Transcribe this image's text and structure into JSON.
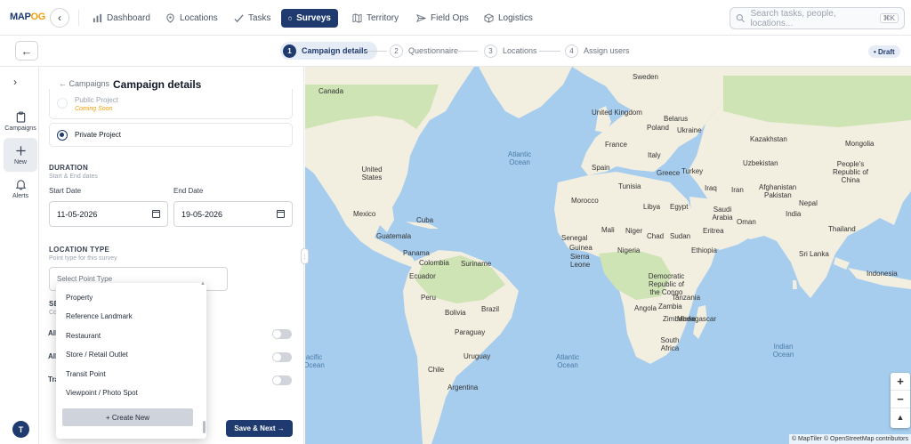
{
  "app": {
    "logo_main": "MAP",
    "logo_accent": "OG"
  },
  "nav": {
    "items": [
      {
        "label": "Dashboard",
        "icon": "bar-chart-icon"
      },
      {
        "label": "Locations",
        "icon": "map-pin-icon"
      },
      {
        "label": "Tasks",
        "icon": "check-icon"
      },
      {
        "label": "Surveys",
        "icon": "clipboard-icon",
        "active": true
      },
      {
        "label": "Territory",
        "icon": "map-icon"
      },
      {
        "label": "Field Ops",
        "icon": "send-icon"
      },
      {
        "label": "Logistics",
        "icon": "box-icon"
      }
    ],
    "search_placeholder": "Search tasks, people, locations...",
    "search_shortcut": "⌘K"
  },
  "stepper": {
    "steps": [
      {
        "num": "1",
        "label": "Campaign details",
        "active": true
      },
      {
        "num": "2",
        "label": "Questionnaire"
      },
      {
        "num": "3",
        "label": "Locations"
      },
      {
        "num": "4",
        "label": "Assign users"
      }
    ],
    "status": "• Draft"
  },
  "rail": {
    "items": [
      {
        "label": "Campaigns",
        "icon": "clipboard-icon"
      },
      {
        "label": "New",
        "icon": "plus-icon",
        "selected": true
      },
      {
        "label": "Alerts",
        "icon": "bell-icon"
      }
    ],
    "avatar_initial": "T"
  },
  "form": {
    "breadcrumb": "← Campaigns",
    "title": "Campaign details",
    "public_project": {
      "label": "Public Project",
      "note": "Coming Soon"
    },
    "private_project": {
      "label": "Private Project"
    },
    "duration": {
      "heading": "DURATION",
      "hint": "Start & End dates",
      "start_label": "Start Date",
      "start_value": "11-05-2026",
      "end_label": "End Date",
      "end_value": "19-05-2026"
    },
    "location_type": {
      "heading": "LOCATION TYPE",
      "hint": "Point type for this survey",
      "placeholder": "Select Point Type"
    },
    "hidden_section": {
      "heading": "SE",
      "hint": "Co"
    },
    "toggle_rows": [
      "All",
      "All",
      "Tra"
    ],
    "save_label": "Save & Next →"
  },
  "dropdown": {
    "options": [
      "Property",
      "Reference Landmark",
      "Restaurant",
      "Store / Retail Outlet",
      "Transit Point",
      "Viewpoint / Photo Spot"
    ],
    "create_label": "+ Create New"
  },
  "map": {
    "land_color": "#f2eee0",
    "forest_color": "#cfe4b5",
    "water_color": "#a6cdee",
    "labels": [
      "Canada",
      "Sweden",
      "United Kingdom",
      "Belarus",
      "Poland",
      "Ukraine",
      "France",
      "Italy",
      "Spain",
      "Kazakhstan",
      "Mongolia",
      "Uzbekistan",
      "People's Republic of China",
      "Turkey",
      "Greece",
      "Tunisia",
      "Iraq",
      "Iran",
      "Afghanistan",
      "Pakistan",
      "Morocco",
      "Libya",
      "Egypt",
      "Saudi Arabia",
      "Oman",
      "India",
      "Nepal",
      "Thailand",
      "Sri Lanka",
      "Mali",
      "Niger",
      "Chad",
      "Sudan",
      "Eritrea",
      "Senegal",
      "Guinea",
      "Sierra Leone",
      "Nigeria",
      "Ethiopia",
      "Democratic Republic of the Congo",
      "Tanzania",
      "Angola",
      "Zambia",
      "Zimbabwe",
      "Madagascar",
      "South Africa",
      "Indonesia",
      "United States",
      "Mexico",
      "Cuba",
      "Guatemala",
      "Panama",
      "Colombia",
      "Suriname",
      "Ecuador",
      "Peru",
      "Brazil",
      "Bolivia",
      "Paraguay",
      "Chile",
      "Uruguay",
      "Argentina"
    ],
    "oceans": [
      "Atlantic Ocean",
      "Atlantic Ocean",
      "Indian Ocean",
      "acific Ocean"
    ],
    "zoom_in": "+",
    "zoom_out": "−",
    "compass": "▲",
    "attribution": "© MapTiler © OpenStreetMap contributors"
  }
}
